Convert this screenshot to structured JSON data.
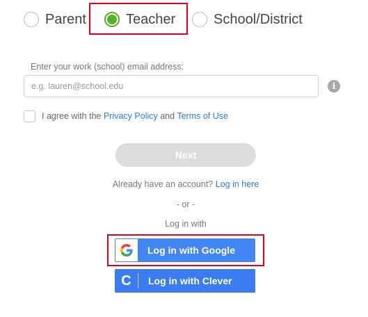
{
  "roles": [
    {
      "label": "Parent",
      "selected": false
    },
    {
      "label": "Teacher",
      "selected": true
    },
    {
      "label": "School/District",
      "selected": false
    }
  ],
  "email": {
    "label": "Enter your work (school) email address:",
    "placeholder": "e.g. lauren@school.edu",
    "value": ""
  },
  "info_icon": {
    "glyph": "i"
  },
  "agree": {
    "checked": false,
    "prefix": "I agree with the ",
    "privacy_link": "Privacy Policy",
    "and": " and ",
    "terms_link": "Terms of Use"
  },
  "next_button": {
    "label": "Next",
    "enabled": false
  },
  "account": {
    "prompt": "Already have an account? ",
    "login_link": "Log in here"
  },
  "separator": "- or -",
  "login_with": "Log in with",
  "social": {
    "google": {
      "label": "Log in with Google",
      "logo": "G"
    },
    "clever": {
      "label": "Log in with Clever",
      "logo": "C"
    }
  },
  "colors": {
    "selected_radio": "#53b226",
    "highlight": "#e0001b",
    "link": "#2b7bd6",
    "social_button": "#4285f4",
    "next_disabled": "#dcdcdc"
  }
}
